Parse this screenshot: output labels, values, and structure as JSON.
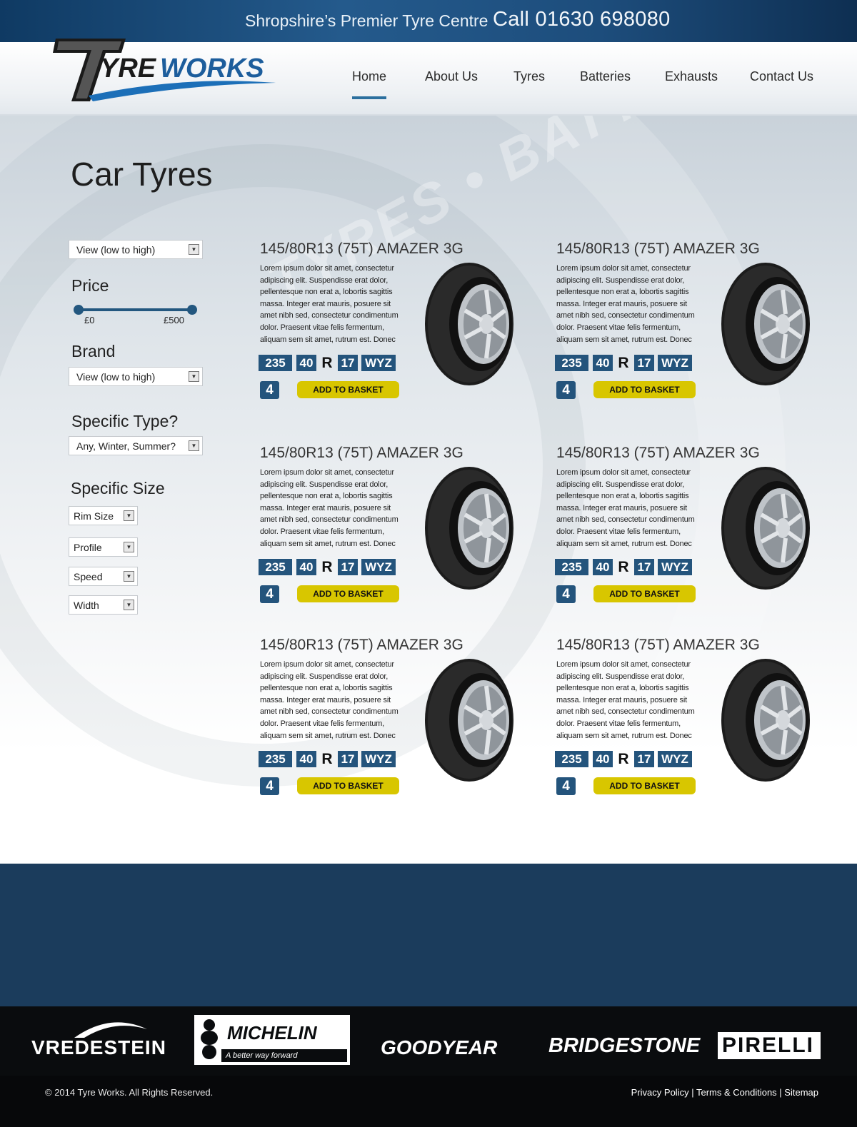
{
  "topbar": {
    "tagline": "Shropshire’s Premier Tyre Centre",
    "phone": "Call 01630 698080"
  },
  "logo": {
    "text": "TYREWORKS"
  },
  "nav": {
    "items": [
      "Home",
      "About Us",
      "Tyres",
      "Batteries",
      "Exhausts",
      "Contact Us"
    ],
    "active": "Home"
  },
  "watermark": "TYRES • BATTERIES • EXHAUSTS",
  "page": {
    "title": "Car Tyres"
  },
  "sidebar": {
    "sort_select": "View (low to high)",
    "price_label": "Price",
    "price_min": "£0",
    "price_max": "£500",
    "brand_label": "Brand",
    "brand_select": "View (low to high)",
    "type_label": "Specific Type?",
    "type_select": "Any, Winter, Summer?",
    "size_label": "Specific Size",
    "size_selects": [
      "Rim Size",
      "Profile",
      "Speed",
      "Width"
    ]
  },
  "products": [
    {
      "title": "145/80R13 (75T) AMAZER 3G",
      "description": "Lorem ipsum dolor sit amet, consectetur adipiscing elit. Suspendisse erat dolor, pellentesque non erat a, lobortis sagittis massa. Integer erat mauris, posuere sit amet nibh sed, consectetur condimentum dolor. Praesent vitae felis fermentum, aliquam sem sit amet, rutrum est. Donec",
      "width": "235",
      "profile": "40",
      "construction": "R",
      "rim": "17",
      "speed": "WYZ",
      "qty": "4",
      "button": "ADD TO BASKET"
    },
    {
      "title": "145/80R13 (75T) AMAZER 3G",
      "description": "Lorem ipsum dolor sit amet, consectetur adipiscing elit. Suspendisse erat dolor, pellentesque non erat a, lobortis sagittis massa. Integer erat mauris, posuere sit amet nibh sed, consectetur condimentum dolor. Praesent vitae felis fermentum, aliquam sem sit amet, rutrum est. Donec",
      "width": "235",
      "profile": "40",
      "construction": "R",
      "rim": "17",
      "speed": "WYZ",
      "qty": "4",
      "button": "ADD TO BASKET"
    },
    {
      "title": "145/80R13 (75T) AMAZER 3G",
      "description": "Lorem ipsum dolor sit amet, consectetur adipiscing elit. Suspendisse erat dolor, pellentesque non erat a, lobortis sagittis massa. Integer erat mauris, posuere sit amet nibh sed, consectetur condimentum dolor. Praesent vitae felis fermentum, aliquam sem sit amet, rutrum est. Donec",
      "width": "235",
      "profile": "40",
      "construction": "R",
      "rim": "17",
      "speed": "WYZ",
      "qty": "4",
      "button": "ADD TO BASKET"
    },
    {
      "title": "145/80R13 (75T) AMAZER 3G",
      "description": "Lorem ipsum dolor sit amet, consectetur adipiscing elit. Suspendisse erat dolor, pellentesque non erat a, lobortis sagittis massa. Integer erat mauris, posuere sit amet nibh sed, consectetur condimentum dolor. Praesent vitae felis fermentum, aliquam sem sit amet, rutrum est. Donec",
      "width": "235",
      "profile": "40",
      "construction": "R",
      "rim": "17",
      "speed": "WYZ",
      "qty": "4",
      "button": "ADD TO BASKET"
    },
    {
      "title": "145/80R13 (75T) AMAZER 3G",
      "description": "Lorem ipsum dolor sit amet, consectetur adipiscing elit. Suspendisse erat dolor, pellentesque non erat a, lobortis sagittis massa. Integer erat mauris, posuere sit amet nibh sed, consectetur condimentum dolor. Praesent vitae felis fermentum, aliquam sem sit amet, rutrum est. Donec",
      "width": "235",
      "profile": "40",
      "construction": "R",
      "rim": "17",
      "speed": "WYZ",
      "qty": "4",
      "button": "ADD TO BASKET"
    },
    {
      "title": "145/80R13 (75T) AMAZER 3G",
      "description": "Lorem ipsum dolor sit amet, consectetur adipiscing elit. Suspendisse erat dolor, pellentesque non erat a, lobortis sagittis massa. Integer erat mauris, posuere sit amet nibh sed, consectetur condimentum dolor. Praesent vitae felis fermentum, aliquam sem sit amet, rutrum est. Donec",
      "width": "235",
      "profile": "40",
      "construction": "R",
      "rim": "17",
      "speed": "WYZ",
      "qty": "4",
      "button": "ADD TO BASKET"
    }
  ],
  "brands": [
    "VREDESTEIN",
    "MICHELIN",
    "A better way forward",
    "GOODYEAR",
    "BRIDGESTONE",
    "PIRELLI"
  ],
  "footer": {
    "copyright": "© 2014 Tyre Works. All Rights Reserved.",
    "links": [
      "Privacy Policy",
      "Terms & Conditions",
      "Sitemap"
    ],
    "separator": " | "
  },
  "colors": {
    "accent": "#24547c",
    "button": "#d8c600",
    "footer_bg": "#1b3c5c",
    "brand_bar": "#0a0c0e"
  },
  "icons": {
    "dropdown": "chevron-down-icon"
  }
}
